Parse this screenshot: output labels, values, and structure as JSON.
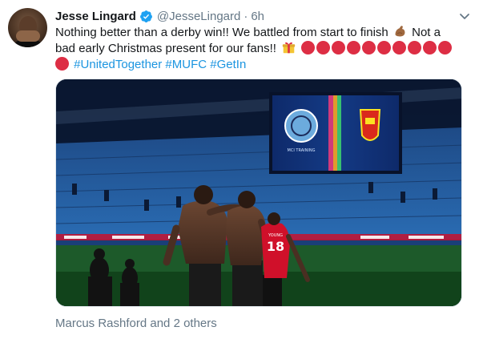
{
  "tweet": {
    "display_name": "Jesse Lingard",
    "handle": "@JesseLingard",
    "separator": "·",
    "time": "6h",
    "text_line1": "Nothing better than a derby win!! We battled from start to finish",
    "text_line1_end": "Not a",
    "text_line2": "bad early Christmas present for our fans!!",
    "hashtags": [
      "#UnitedTogether",
      "#MUFC",
      "#GetIn"
    ],
    "tagged_people": "Marcus Rashford and 2 others"
  },
  "media": {
    "scoreboard_left_caption": "MCI TRAINING",
    "player_shirt_number": "18",
    "player_shirt_name": "YOUNG"
  },
  "icons": {
    "verified": "verified-badge-icon",
    "caret": "chevron-down-icon",
    "muscle": "flexed-biceps-emoji",
    "gift": "wrapped-gift-emoji",
    "red_circle": "red-circle-emoji"
  },
  "colors": {
    "link": "#1b95e0",
    "secondary_text": "#657786",
    "verified": "#1da1f2",
    "red_circle": "#dd2e44"
  },
  "red_circle_count_line2": 10,
  "red_circle_count_line3": 1
}
